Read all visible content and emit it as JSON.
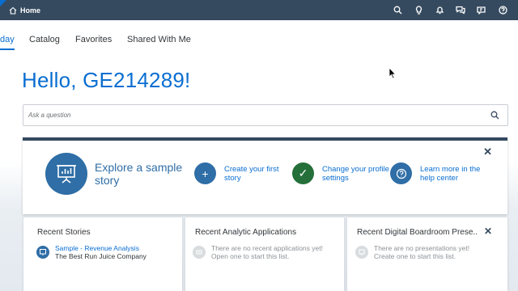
{
  "shellbar": {
    "home_label": "Home",
    "icons": [
      "search-icon",
      "lightbulb-icon",
      "bell-icon",
      "chat-icon",
      "feedback-icon",
      "help-icon"
    ]
  },
  "tabs": [
    {
      "label": "day",
      "active": true
    },
    {
      "label": "Catalog",
      "active": false
    },
    {
      "label": "Favorites",
      "active": false
    },
    {
      "label": "Shared With Me",
      "active": false
    }
  ],
  "greeting": "Hello, GE214289!",
  "search": {
    "placeholder": "Ask a question"
  },
  "welcome": {
    "explore_label": "Explore a sample story",
    "actions": [
      {
        "label": "Create your first story",
        "icon": "plus-icon",
        "color": "#2f6ea6"
      },
      {
        "label": "Change your profile settings",
        "icon": "check-icon",
        "color": "#256f3a"
      },
      {
        "label": "Learn more in the help center",
        "icon": "help-icon",
        "color": "#2f6ea6"
      }
    ],
    "close_label": "✕"
  },
  "cards": [
    {
      "title": "Recent Stories",
      "item_title": "Sample - Revenue Analysis",
      "item_subtitle": "The Best Run Juice Company"
    },
    {
      "title": "Recent Analytic Applications",
      "empty_line1": "There are no recent applications yet!",
      "empty_line2": "Open one to start this list."
    },
    {
      "title": "Recent Digital Boardroom Prese...",
      "empty_line1": "There are no presentations yet!",
      "empty_line2": "Create one to start this list.",
      "close_label": "✕"
    }
  ],
  "colors": {
    "shell": "#354a5f",
    "accent": "#0a6ed1",
    "brand_blue": "#2f6ea6",
    "green": "#256f3a"
  }
}
